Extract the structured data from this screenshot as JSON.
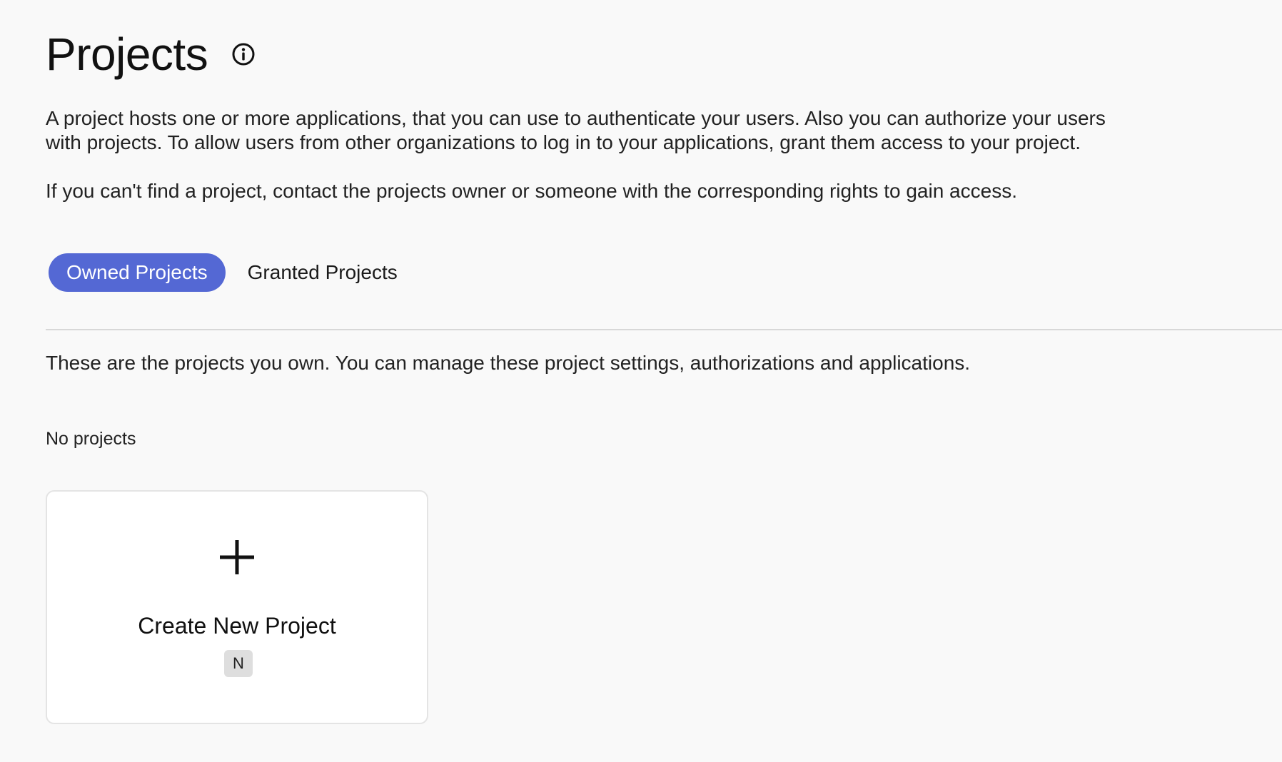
{
  "header": {
    "title": "Projects",
    "info_icon": "info-circle-icon"
  },
  "intro": {
    "paragraph_1": "A project hosts one or more applications, that you can use to authenticate your users. Also you can authorize your users with projects. To allow users from other organizations to log in to your applications, grant them access to your project.",
    "paragraph_2": "If you can't find a project, contact the projects owner or someone with the corresponding rights to gain access."
  },
  "tabs": [
    {
      "label": "Owned Projects",
      "active": true
    },
    {
      "label": "Granted Projects",
      "active": false
    }
  ],
  "owned": {
    "description": "These are the projects you own. You can manage these project settings, authorizations and applications.",
    "empty_label": "No projects",
    "create_card": {
      "icon": "plus-icon",
      "label": "Create New Project",
      "shortcut": "N"
    }
  },
  "colors": {
    "accent": "#5468d4",
    "background": "#f9f9f9",
    "card_background": "#ffffff",
    "divider": "#d8d8d8",
    "shortcut_badge": "#dedede"
  }
}
